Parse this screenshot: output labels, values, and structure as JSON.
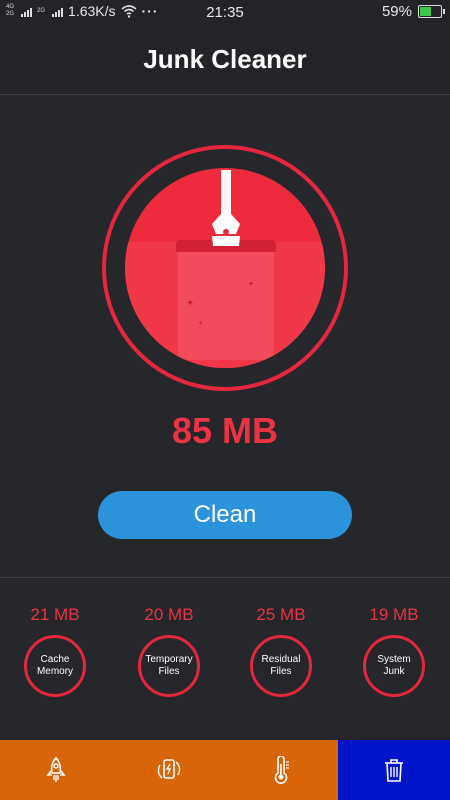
{
  "status_bar": {
    "network_top": "4G",
    "network_bottom": "2G",
    "network_second": "2G",
    "speed": "1.63K/s",
    "more": "···",
    "time": "21:35",
    "battery": "59%",
    "battery_level": 0.59
  },
  "header": {
    "title": "Junk Cleaner"
  },
  "gauge": {
    "junk_size": "85 MB"
  },
  "clean_button": {
    "label": "Clean"
  },
  "categories": [
    {
      "amount": "21 MB",
      "label1": "Cache",
      "label2": "Memory"
    },
    {
      "amount": "20 MB",
      "label1": "Temporary",
      "label2": "Files"
    },
    {
      "amount": "25 MB",
      "label1": "Residual",
      "label2": "Files"
    },
    {
      "amount": "19 MB",
      "label1": "System",
      "label2": "Junk"
    }
  ],
  "bottom_nav": [
    {
      "icon": "rocket-icon",
      "active": false
    },
    {
      "icon": "phone-cooling-icon",
      "active": false
    },
    {
      "icon": "thermometer-icon",
      "active": false
    },
    {
      "icon": "trash-icon",
      "active": true
    }
  ],
  "colors": {
    "accent_red": "#e4273c",
    "button_blue": "#2b93d9",
    "nav_orange": "#d9650a",
    "nav_active": "#0015c8"
  }
}
